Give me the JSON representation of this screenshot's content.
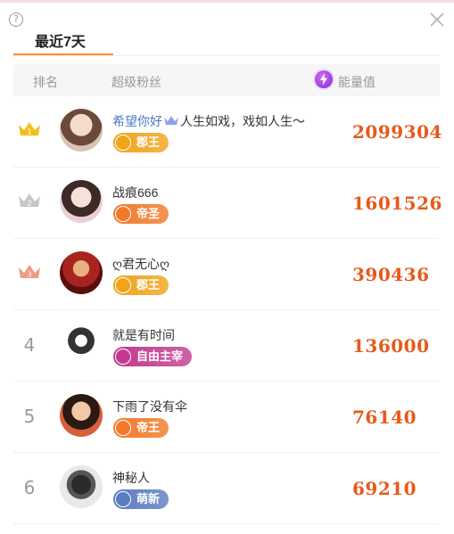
{
  "help_icon_glyph": "?",
  "tab": {
    "title": "最近7天"
  },
  "header": {
    "rank": "排名",
    "fan": "超级粉丝",
    "energy": "能量值"
  },
  "accent_color": "#e65a1b",
  "rows": [
    {
      "rank": "1",
      "rank_icon": "gold-crown-icon",
      "name_highlight": "希望你好",
      "name_rest": "人生如戏，戏如人生～",
      "badge": "郡王",
      "badge_color": "#f0a41a",
      "energy": "2099304"
    },
    {
      "rank": "2",
      "rank_icon": "silver-crown-icon",
      "name_highlight": "",
      "name_rest": "战痕666",
      "badge": "帝圣",
      "badge_color": "#f07a2a",
      "energy": "1601526"
    },
    {
      "rank": "3",
      "rank_icon": "bronze-crown-icon",
      "name_highlight": "",
      "name_rest": "ღ君无心ღ",
      "badge": "郡王",
      "badge_color": "#f0a41a",
      "energy": "390436"
    },
    {
      "rank": "4",
      "rank_icon": "",
      "name_highlight": "",
      "name_rest": "就是有时间",
      "badge": "自由主宰",
      "badge_color": "#c23a8e",
      "energy": "136000"
    },
    {
      "rank": "5",
      "rank_icon": "",
      "name_highlight": "",
      "name_rest": "下雨了没有伞",
      "badge": "帝王",
      "badge_color": "#f07a2a",
      "energy": "76140"
    },
    {
      "rank": "6",
      "rank_icon": "",
      "name_highlight": "",
      "name_rest": "神秘人",
      "badge": "萌新",
      "badge_color": "#5b7cc0",
      "energy": "69210"
    }
  ]
}
